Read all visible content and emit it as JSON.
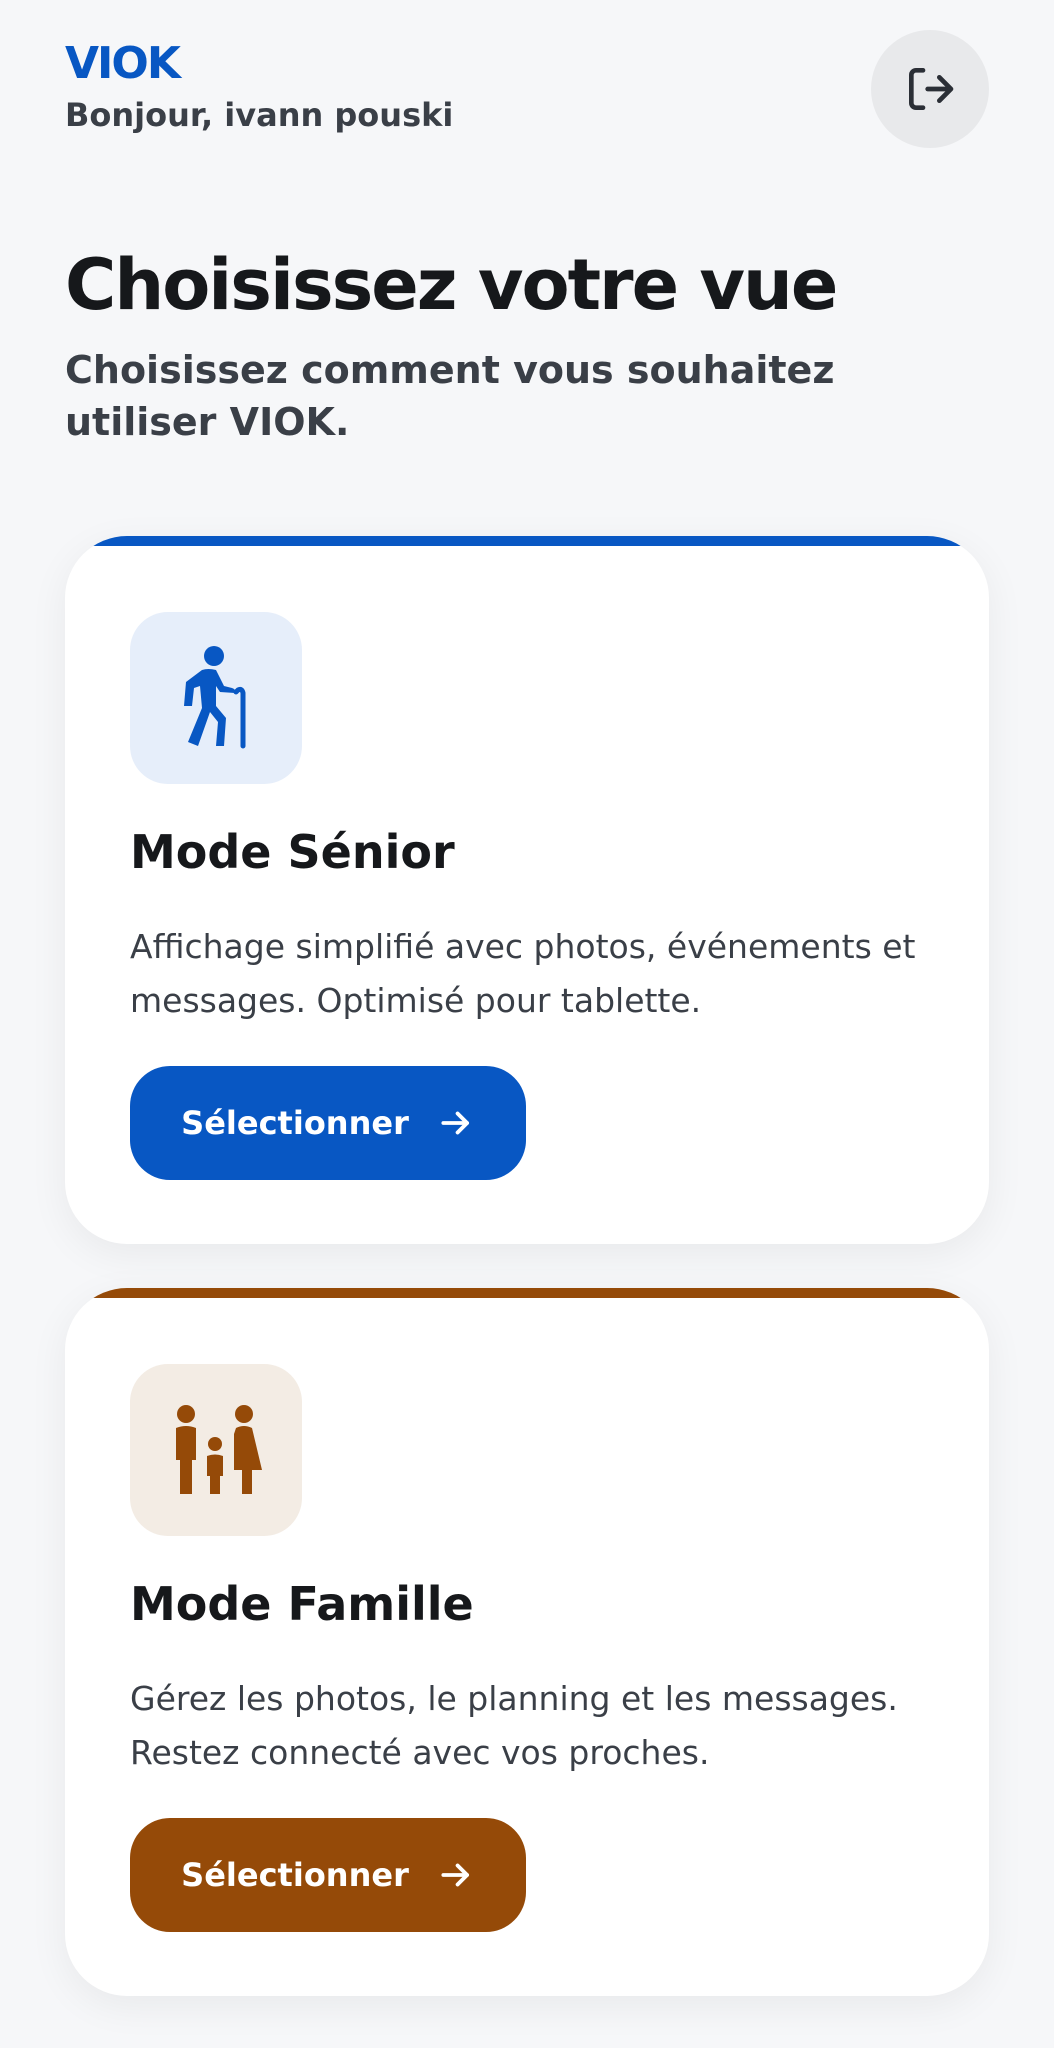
{
  "header": {
    "brand": "VIOK",
    "greeting": "Bonjour, ivann pouski"
  },
  "page": {
    "title": "Choisissez votre vue",
    "subtitle": "Choisissez comment vous souhaitez utiliser VIOK."
  },
  "cards": [
    {
      "title": "Mode Sénior",
      "description": "Affichage simplifié avec photos, événements et messages. Optimisé pour tablette.",
      "button_label": "Sélectionner",
      "icon": "elderly-person-with-cane-icon",
      "accent_color": "#0857c3",
      "icon_bg_color": "#e6eefa"
    },
    {
      "title": "Mode Famille",
      "description": "Gérez les photos, le planning et les messages. Restez connecté avec vos proches.",
      "button_label": "Sélectionner",
      "icon": "family-icon",
      "accent_color": "#954a08",
      "icon_bg_color": "#f3ece4"
    }
  ],
  "colors": {
    "background": "#f6f7f9",
    "brand": "#0857c3",
    "logout_bg": "#e8e9eb"
  }
}
